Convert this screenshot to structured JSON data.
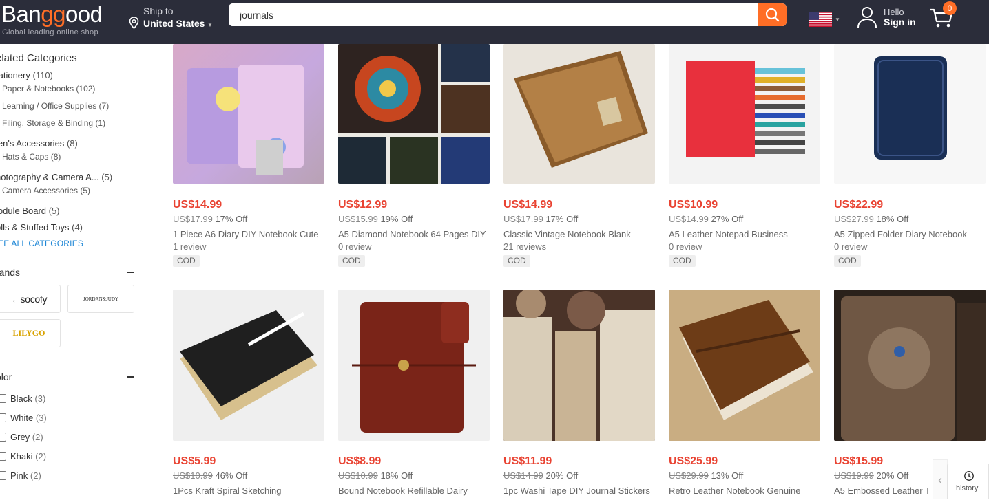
{
  "header": {
    "logo_pre": "Ban",
    "logo_mid": "gg",
    "logo_post": "ood",
    "slogan": "Global leading online shop",
    "ship_label": "Ship to",
    "ship_country": "United States",
    "search_value": "journals",
    "hello": "Hello",
    "sign_in": "Sign in",
    "cart_count": "0",
    "accent_color": "#ff6e26"
  },
  "sidebar": {
    "related_title": "elated Categories",
    "categories": [
      {
        "label": "tationery",
        "count": "(110)"
      },
      {
        "label": "Paper & Notebooks",
        "count": "(102)"
      },
      {
        "label": "Learning / Office Supplies",
        "count": "(7)"
      },
      {
        "label": "Filing, Storage & Binding",
        "count": "(1)"
      },
      {
        "label": "len's Accessories",
        "count": "(8)"
      },
      {
        "label": "Hats & Caps",
        "count": "(8)"
      },
      {
        "label": "hotography & Camera A...",
        "count": "(5)"
      },
      {
        "label": "Camera Accessories",
        "count": "(5)"
      },
      {
        "label": "lodule Board",
        "count": "(5)"
      },
      {
        "label": "olls & Stuffed Toys",
        "count": "(4)"
      }
    ],
    "see_all": "EE ALL CATEGORIES",
    "brands_title": "rands",
    "brands": [
      "←socofy",
      "JORDAN&JUDY",
      "LILYGO"
    ],
    "color_title": "olor",
    "colors": [
      {
        "label": "Black",
        "count": "(3)"
      },
      {
        "label": "White",
        "count": "(3)"
      },
      {
        "label": "Grey",
        "count": "(2)"
      },
      {
        "label": "Khaki",
        "count": "(2)"
      },
      {
        "label": "Pink",
        "count": "(2)"
      }
    ]
  },
  "products": [
    {
      "price": "US$14.99",
      "orig": "US$17.99",
      "off": "17% Off",
      "title": "1 Piece A6 Diary DIY Notebook Cute",
      "reviews": "1 review",
      "cod": "COD"
    },
    {
      "price": "US$12.99",
      "orig": "US$15.99",
      "off": "19% Off",
      "title": "A5 Diamond Notebook 64 Pages DIY",
      "reviews": "0 review",
      "cod": "COD"
    },
    {
      "price": "US$14.99",
      "orig": "US$17.99",
      "off": "17% Off",
      "title": "Classic Vintage Notebook Blank",
      "reviews": "21 reviews",
      "cod": "COD"
    },
    {
      "price": "US$10.99",
      "orig": "US$14.99",
      "off": "27% Off",
      "title": "A5 Leather Notepad Business",
      "reviews": "0 review",
      "cod": "COD"
    },
    {
      "price": "US$22.99",
      "orig": "US$27.99",
      "off": "18% Off",
      "title": "A5 Zipped Folder Diary Notebook",
      "reviews": "0 review",
      "cod": "COD"
    },
    {
      "price": "US$5.99",
      "orig": "US$10.99",
      "off": "46% Off",
      "title": "1Pcs Kraft Spiral Sketching",
      "reviews": "",
      "cod": ""
    },
    {
      "price": "US$8.99",
      "orig": "US$10.99",
      "off": "18% Off",
      "title": "Bound Notebook Refillable Dairy",
      "reviews": "",
      "cod": ""
    },
    {
      "price": "US$11.99",
      "orig": "US$14.99",
      "off": "20% Off",
      "title": "1pc Washi Tape DIY Journal Stickers",
      "reviews": "",
      "cod": ""
    },
    {
      "price": "US$25.99",
      "orig": "US$29.99",
      "off": "13% Off",
      "title": "Retro Leather Notebook Genuine",
      "reviews": "",
      "cod": ""
    },
    {
      "price": "US$15.99",
      "orig": "US$19.99",
      "off": "20% Off",
      "title": "A5 Embossed Leather T",
      "reviews": "",
      "cod": ""
    }
  ],
  "history": {
    "label": "history"
  }
}
